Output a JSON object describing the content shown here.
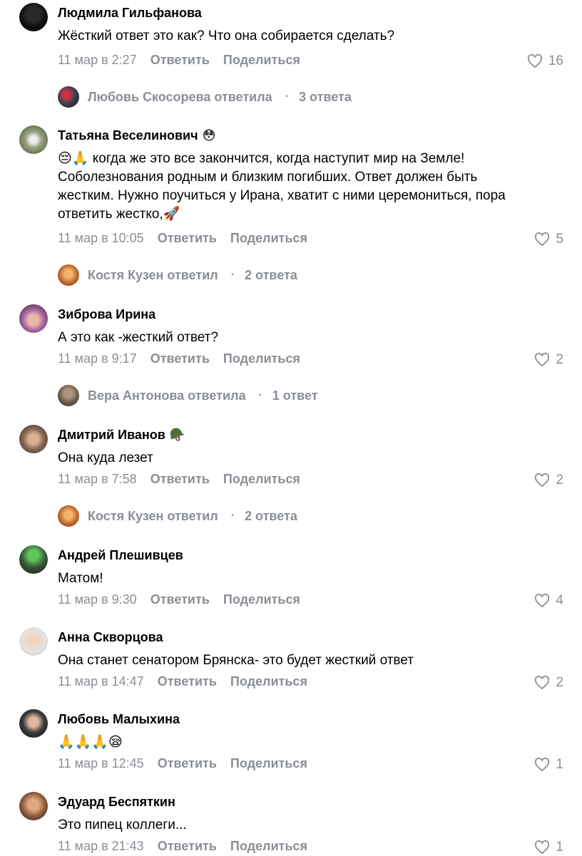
{
  "colors": {
    "meta_gray": "#8a8f96",
    "text": "#000000",
    "background": "#ffffff"
  },
  "actions": {
    "reply": "Ответить",
    "share": "Поделиться"
  },
  "comments": [
    {
      "author": "Людмила Гильфанова",
      "badge": "",
      "avatar_icon": "user-avatar",
      "lines": [
        "Жёсткий ответ это как? Что она собирается сделать?"
      ],
      "date": "11 мар в 2:27",
      "likes": "16",
      "replies": {
        "text": "Любовь Скосорева ответила",
        "count": "3 ответа"
      }
    },
    {
      "author": "Татьяна Веселинович",
      "badge": "😳",
      "avatar_icon": "user-avatar",
      "lines": [
        "😔🙏 когда же это все закончится, когда наступит мир на Земле!",
        "Соболезнования родным и близким погибших. Ответ должен быть",
        "жестким. Нужно поучиться у Ирана, хватит с ними церемониться, пора",
        "ответить жестко,🚀"
      ],
      "date": "11 мар в 10:05",
      "likes": "5",
      "replies": {
        "text": "Костя Кузен ответил",
        "count": "2 ответа"
      }
    },
    {
      "author": "Зиброва Ирина",
      "badge": "",
      "avatar_icon": "user-avatar",
      "lines": [
        "А это как -жесткий ответ?"
      ],
      "date": "11 мар в 9:17",
      "likes": "2",
      "replies": {
        "text": "Вера Антонова ответила",
        "count": "1 ответ"
      }
    },
    {
      "author": "Дмитрий Иванов",
      "badge": "🪖",
      "avatar_icon": "user-avatar",
      "lines": [
        "Она куда лезет"
      ],
      "date": "11 мар в 7:58",
      "likes": "2",
      "replies": {
        "text": "Костя Кузен ответил",
        "count": "2 ответа"
      }
    },
    {
      "author": "Андрей Плешивцев",
      "badge": "",
      "avatar_icon": "user-avatar",
      "lines": [
        "Матом!"
      ],
      "date": "11 мар в 9:30",
      "likes": "4",
      "replies": null
    },
    {
      "author": "Анна Скворцова",
      "badge": "",
      "avatar_icon": "user-avatar",
      "lines": [
        "Она станет сенатором Брянска- это будет жесткий ответ"
      ],
      "date": "11 мар в 14:47",
      "likes": "2",
      "replies": null
    },
    {
      "author": "Любовь Малыхина",
      "badge": "",
      "avatar_icon": "user-avatar",
      "lines": [
        "🙏🙏🙏😪"
      ],
      "date": "11 мар в 12:45",
      "likes": "1",
      "replies": null
    },
    {
      "author": "Эдуард Беспяткин",
      "badge": "",
      "avatar_icon": "user-avatar",
      "lines": [
        "Это пипец коллеги..."
      ],
      "date": "11 мар в 21:43",
      "likes": "1",
      "replies": null
    }
  ]
}
